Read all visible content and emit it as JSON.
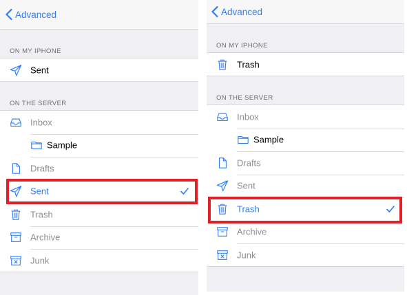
{
  "colors": {
    "accent": "#2f7df6",
    "highlight": "#e02027",
    "secondary_text": "#8e8e93"
  },
  "left": {
    "back_label": "Advanced",
    "section_local": "ON MY IPHONE",
    "local_item": {
      "label": "Sent",
      "icon": "paper-plane-icon"
    },
    "section_server": "ON THE SERVER",
    "server_items": [
      {
        "label": "Inbox",
        "icon": "tray-icon"
      },
      {
        "label": "Sample",
        "icon": "folder-icon"
      },
      {
        "label": "Drafts",
        "icon": "document-icon"
      },
      {
        "label": "Sent",
        "icon": "paper-plane-icon",
        "selected": true
      },
      {
        "label": "Trash",
        "icon": "trash-icon"
      },
      {
        "label": "Archive",
        "icon": "archive-box-icon"
      },
      {
        "label": "Junk",
        "icon": "junk-box-icon"
      }
    ]
  },
  "right": {
    "back_label": "Advanced",
    "section_local": "ON MY IPHONE",
    "local_item": {
      "label": "Trash",
      "icon": "trash-icon"
    },
    "section_server": "ON THE SERVER",
    "server_items": [
      {
        "label": "Inbox",
        "icon": "tray-icon"
      },
      {
        "label": "Sample",
        "icon": "folder-icon"
      },
      {
        "label": "Drafts",
        "icon": "document-icon"
      },
      {
        "label": "Sent",
        "icon": "paper-plane-icon"
      },
      {
        "label": "Trash",
        "icon": "trash-icon",
        "selected": true
      },
      {
        "label": "Archive",
        "icon": "archive-box-icon"
      },
      {
        "label": "Junk",
        "icon": "junk-box-icon"
      }
    ]
  }
}
